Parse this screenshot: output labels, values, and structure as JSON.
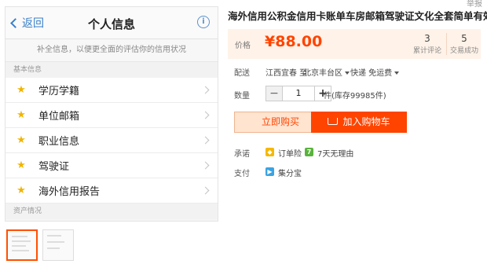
{
  "corner_label": "举报",
  "phone": {
    "back_label": "返回",
    "nav_title": "个人信息",
    "info_icon": "i",
    "hint": "补全信息，以便更全面的评估你的信用状况",
    "section_basic": "基本信息",
    "items": [
      {
        "label": "学历学籍",
        "icon": "star-icon"
      },
      {
        "label": "单位邮箱",
        "icon": "star-icon"
      },
      {
        "label": "职业信息",
        "icon": "star-icon"
      },
      {
        "label": "驾驶证",
        "icon": "star-icon"
      },
      {
        "label": "海外信用报告",
        "icon": "star-icon"
      }
    ],
    "section_assets": "资产情况"
  },
  "product": {
    "title": "海外信用公积金信用卡账单车房邮箱驾驶证文化全套简单有效",
    "price_label": "价格",
    "price": "¥88.00",
    "reviews_count": "3",
    "reviews_label": "累计评论",
    "sales_count": "5",
    "sales_label": "交易成功",
    "shipping_label": "配送",
    "ship_from": "江西宜春 至",
    "ship_to": "北京丰台区",
    "delivery": "快递 免运费",
    "quantity_label": "数量",
    "quantity": "1",
    "minus": "−",
    "plus": "+",
    "stock": "件(库存99985件)",
    "buy_now": "立即购买",
    "add_to_cart": "加入购物车",
    "promise_label": "承诺",
    "promise_1": "订单险",
    "promise_2_badge": "7",
    "promise_2": "7天无理由",
    "payment_label": "支付",
    "payment": "集分宝"
  },
  "colors": {
    "accent": "#ff4400",
    "link": "#3b80c9",
    "star": "#f0b400"
  }
}
